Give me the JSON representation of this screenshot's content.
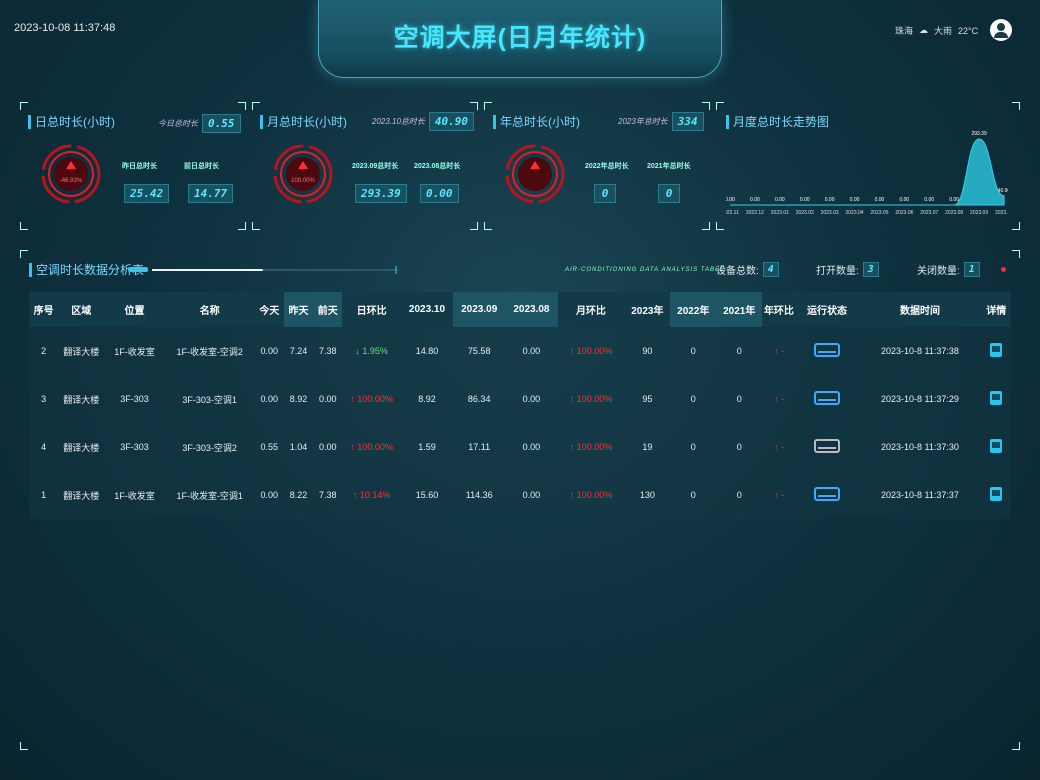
{
  "header": {
    "datetime": "2023-10-08 11:37:48",
    "title": "空调大屏(日月年统计)",
    "city": "珠海",
    "weather": "大雨",
    "temperature": "22°C"
  },
  "day_panel": {
    "title": "日总时长(小时)",
    "today_label": "今日总时长",
    "today_value": "0.55",
    "gauge_percent": "-46.93%",
    "yesterday_label": "昨日总时长",
    "yesterday_value": "25.42",
    "before_label": "前日总时长",
    "before_value": "14.77"
  },
  "month_panel": {
    "title": "月总时长(小时)",
    "current_label": "2023.10总时长",
    "current_value": "40.90",
    "gauge_percent": "100.00%",
    "m1_label": "2023.09总时长",
    "m1_value": "293.39",
    "m2_label": "2023.08总时长",
    "m2_value": "0.00"
  },
  "year_panel": {
    "title": "年总时长(小时)",
    "current_label": "2023年总时长",
    "current_value": "334",
    "y1_label": "2022年总时长",
    "y1_value": "0",
    "y2_label": "2021年总时长",
    "y2_value": "0"
  },
  "trend_panel": {
    "title": "月度总时长走势图"
  },
  "chart_data": {
    "type": "area",
    "title": "月度总时长走势图",
    "categories": [
      "2022.11",
      "2022.12",
      "2023.01",
      "2023.02",
      "2023.03",
      "2023.04",
      "2023.05",
      "2023.06",
      "2023.07",
      "2023.08",
      "2023.09",
      "2023.10"
    ],
    "values": [
      0,
      0,
      0,
      0,
      0,
      0,
      0,
      0,
      0,
      0,
      293.39,
      40.9
    ],
    "value_labels": [
      "0.00",
      "0.00",
      "0.00",
      "0.00",
      "0.00",
      "0.00",
      "0.00",
      "0.00",
      "0.00",
      "0.00",
      "293.39",
      "40.90"
    ],
    "color": "#2fd4ee"
  },
  "analysis": {
    "title": "空调时长数据分析表",
    "subtitle": "AIR-CONDITIONING DATA ANALYSIS TABLE",
    "total_label": "设备总数:",
    "total_value": "4",
    "open_label": "打开数量:",
    "open_value": "3",
    "closed_label": "关闭数量:",
    "closed_value": "1",
    "progress": 0.45
  },
  "table": {
    "headers": [
      "序号",
      "区域",
      "位置",
      "名称",
      "今天",
      "昨天",
      "前天",
      "日环比",
      "2023.10",
      "2023.09",
      "2023.08",
      "月环比",
      "2023年",
      "2022年",
      "2021年",
      "年环比",
      "运行状态",
      "数据时间",
      "详情"
    ],
    "rows": [
      {
        "no": "2",
        "area": "翻译大楼",
        "loc": "1F-收发室",
        "name": "1F-收发室-空调2",
        "today": "0.00",
        "yday": "7.24",
        "bday": "7.38",
        "dratio": "1.95%",
        "ddir": "down",
        "m10": "14.80",
        "m09": "75.58",
        "m08": "0.00",
        "mratio": "100.00%",
        "y23": "90",
        "y22": "0",
        "y21": "0",
        "yratio": "-",
        "status": "on",
        "time": "2023-10-8 11:37:38"
      },
      {
        "no": "3",
        "area": "翻译大楼",
        "loc": "3F-303",
        "name": "3F-303-空调1",
        "today": "0.00",
        "yday": "8.92",
        "bday": "0.00",
        "dratio": "100.00%",
        "ddir": "up",
        "m10": "8.92",
        "m09": "86.34",
        "m08": "0.00",
        "mratio": "100.00%",
        "y23": "95",
        "y22": "0",
        "y21": "0",
        "yratio": "-",
        "status": "on",
        "time": "2023-10-8 11:37:29"
      },
      {
        "no": "4",
        "area": "翻译大楼",
        "loc": "3F-303",
        "name": "3F-303-空调2",
        "today": "0.55",
        "yday": "1.04",
        "bday": "0.00",
        "dratio": "100.00%",
        "ddir": "up",
        "m10": "1.59",
        "m09": "17.11",
        "m08": "0.00",
        "mratio": "100.00%",
        "y23": "19",
        "y22": "0",
        "y21": "0",
        "yratio": "-",
        "status": "off",
        "time": "2023-10-8 11:37:30"
      },
      {
        "no": "1",
        "area": "翻译大楼",
        "loc": "1F-收发室",
        "name": "1F-收发室-空调1",
        "today": "0.00",
        "yday": "8.22",
        "bday": "7.38",
        "dratio": "10.14%",
        "ddir": "up",
        "m10": "15.60",
        "m09": "114.36",
        "m08": "0.00",
        "mratio": "100.00%",
        "y23": "130",
        "y22": "0",
        "y21": "0",
        "yratio": "-",
        "status": "on",
        "time": "2023-10-8 11:37:37"
      }
    ]
  }
}
